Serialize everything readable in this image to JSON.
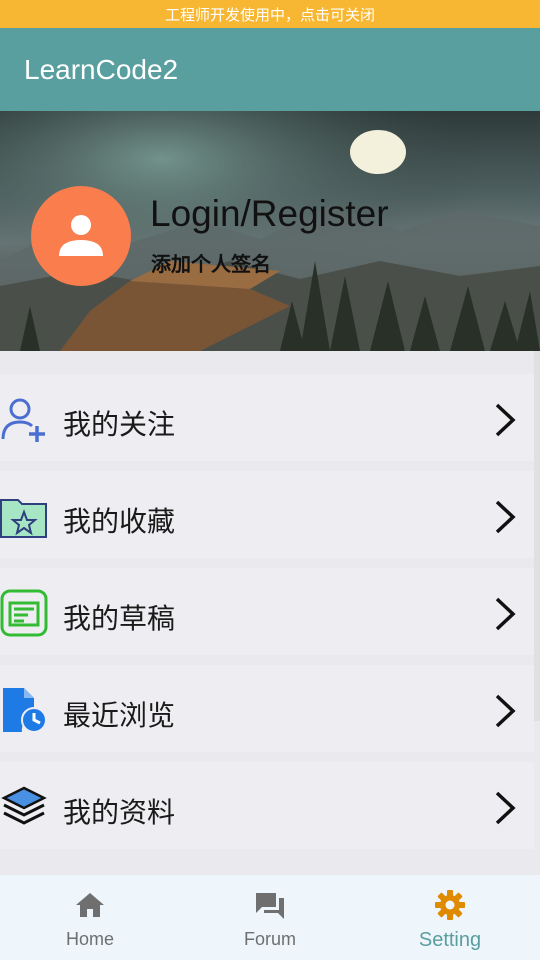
{
  "dev_banner": {
    "text": "工程师开发使用中，点击可关闭"
  },
  "app_bar": {
    "title": "LearnCode2"
  },
  "profile": {
    "login_text": "Login/Register",
    "signature_text": "添加个人签名",
    "avatar_icon": "person-icon",
    "avatar_color": "#fa7d4e"
  },
  "menu": {
    "items": [
      {
        "label": "我的关注",
        "icon": "add-user-icon"
      },
      {
        "label": "我的收藏",
        "icon": "star-folder-icon"
      },
      {
        "label": "我的草稿",
        "icon": "draft-icon"
      },
      {
        "label": "最近浏览",
        "icon": "history-file-icon"
      },
      {
        "label": "我的资料",
        "icon": "layers-icon"
      }
    ]
  },
  "tabs": [
    {
      "label": "Home",
      "icon": "home-icon",
      "active": false
    },
    {
      "label": "Forum",
      "icon": "forum-icon",
      "active": false
    },
    {
      "label": "Setting",
      "icon": "gear-icon",
      "active": true
    }
  ],
  "colors": {
    "banner": "#f7b733",
    "app_bar": "#5a9fa0",
    "accent": "#5a9fa0",
    "active_tab_icon": "#e08a00"
  }
}
